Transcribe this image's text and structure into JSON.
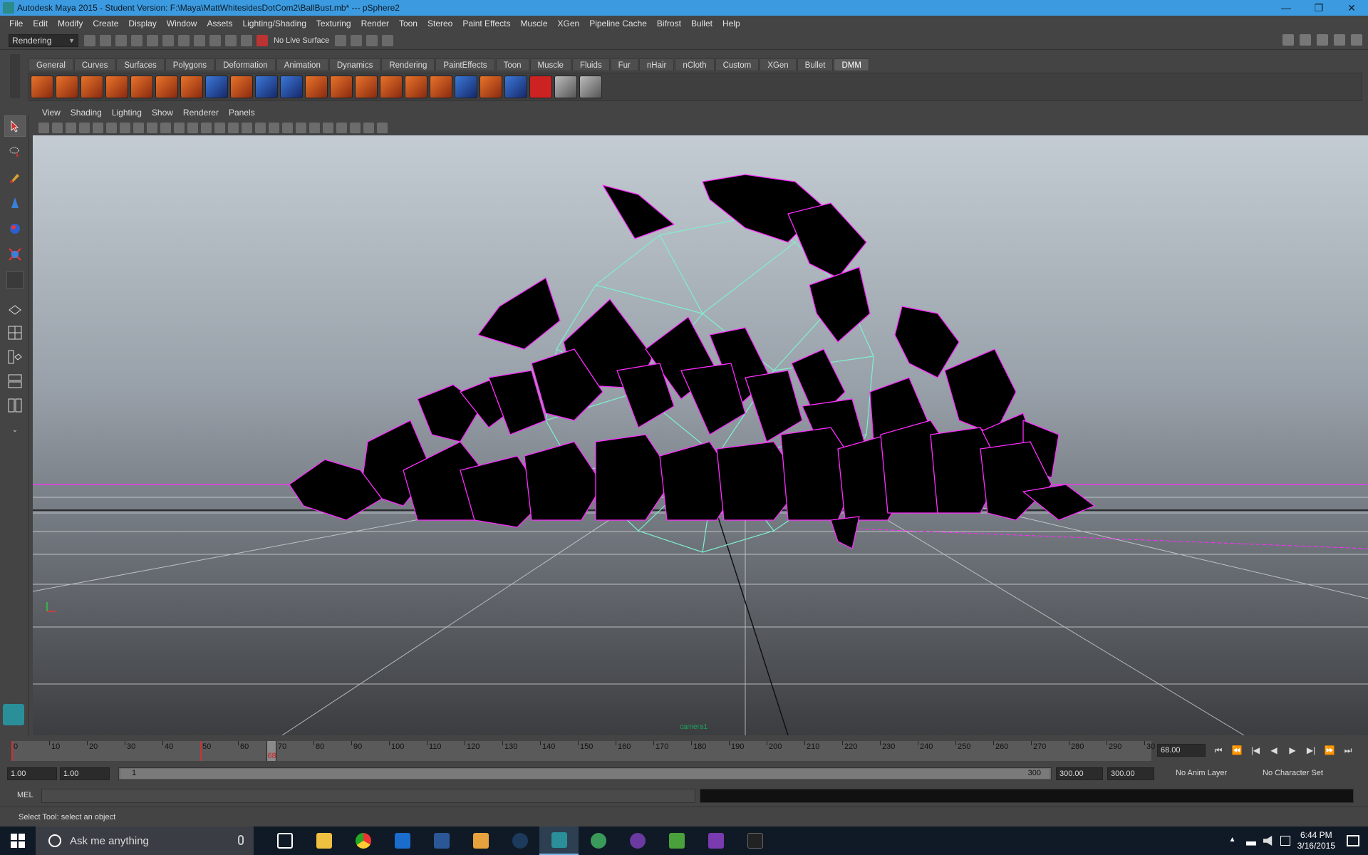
{
  "window": {
    "title": "Autodesk Maya 2015 - Student Version: F:\\Maya\\MattWhitesidesDotCom2\\BallBust.mb*   ---   pSphere2",
    "min": "—",
    "max": "❐",
    "close": "✕"
  },
  "menubar": [
    "File",
    "Edit",
    "Modify",
    "Create",
    "Display",
    "Window",
    "Assets",
    "Lighting/Shading",
    "Texturing",
    "Render",
    "Toon",
    "Stereo",
    "Paint Effects",
    "Muscle",
    "XGen",
    "Pipeline Cache",
    "Bifrost",
    "Bullet",
    "Help"
  ],
  "statusline": {
    "mode": "Rendering",
    "live_surface": "No Live Surface"
  },
  "shelf": {
    "tabs": [
      "General",
      "Curves",
      "Surfaces",
      "Polygons",
      "Deformation",
      "Animation",
      "Dynamics",
      "Rendering",
      "PaintEffects",
      "Toon",
      "Muscle",
      "Fluids",
      "Fur",
      "nHair",
      "nCloth",
      "Custom",
      "XGen",
      "Bullet",
      "DMM"
    ],
    "active_tab": "DMM"
  },
  "panel": {
    "menus": [
      "View",
      "Shading",
      "Lighting",
      "Show",
      "Renderer",
      "Panels"
    ],
    "camera_label": "camera1"
  },
  "timeline": {
    "ticks": [
      "0",
      "10",
      "20",
      "30",
      "40",
      "50",
      "60",
      "70",
      "80",
      "90",
      "100",
      "110",
      "120",
      "130",
      "140",
      "150",
      "160",
      "170",
      "180",
      "190",
      "200",
      "210",
      "220",
      "230",
      "240",
      "250",
      "260",
      "270",
      "280",
      "290",
      "30"
    ],
    "current_frame_label": "68",
    "current_frame_field": "68.00",
    "controls": [
      "⏮",
      "⏪",
      "|◀",
      "◀",
      "▶",
      "▶|",
      "⏩",
      "⏭"
    ]
  },
  "range": {
    "start": "1.00",
    "playback_start": "1.00",
    "slider_start": "1",
    "slider_end": "300",
    "playback_end": "300.00",
    "end": "300.00",
    "anim_layer": "No Anim Layer",
    "character_set": "No Character Set"
  },
  "commandline": {
    "label": "MEL"
  },
  "helpline": {
    "text": "Select Tool: select an object"
  },
  "taskbar": {
    "search_placeholder": "Ask me anything",
    "time": "6:44 PM",
    "date": "3/16/2015"
  },
  "colors": {
    "titlebar": "#3c9be0",
    "wire_magenta": "#ff2cff",
    "wire_cyan": "#7ff0d0",
    "shard_fill": "#000000"
  }
}
